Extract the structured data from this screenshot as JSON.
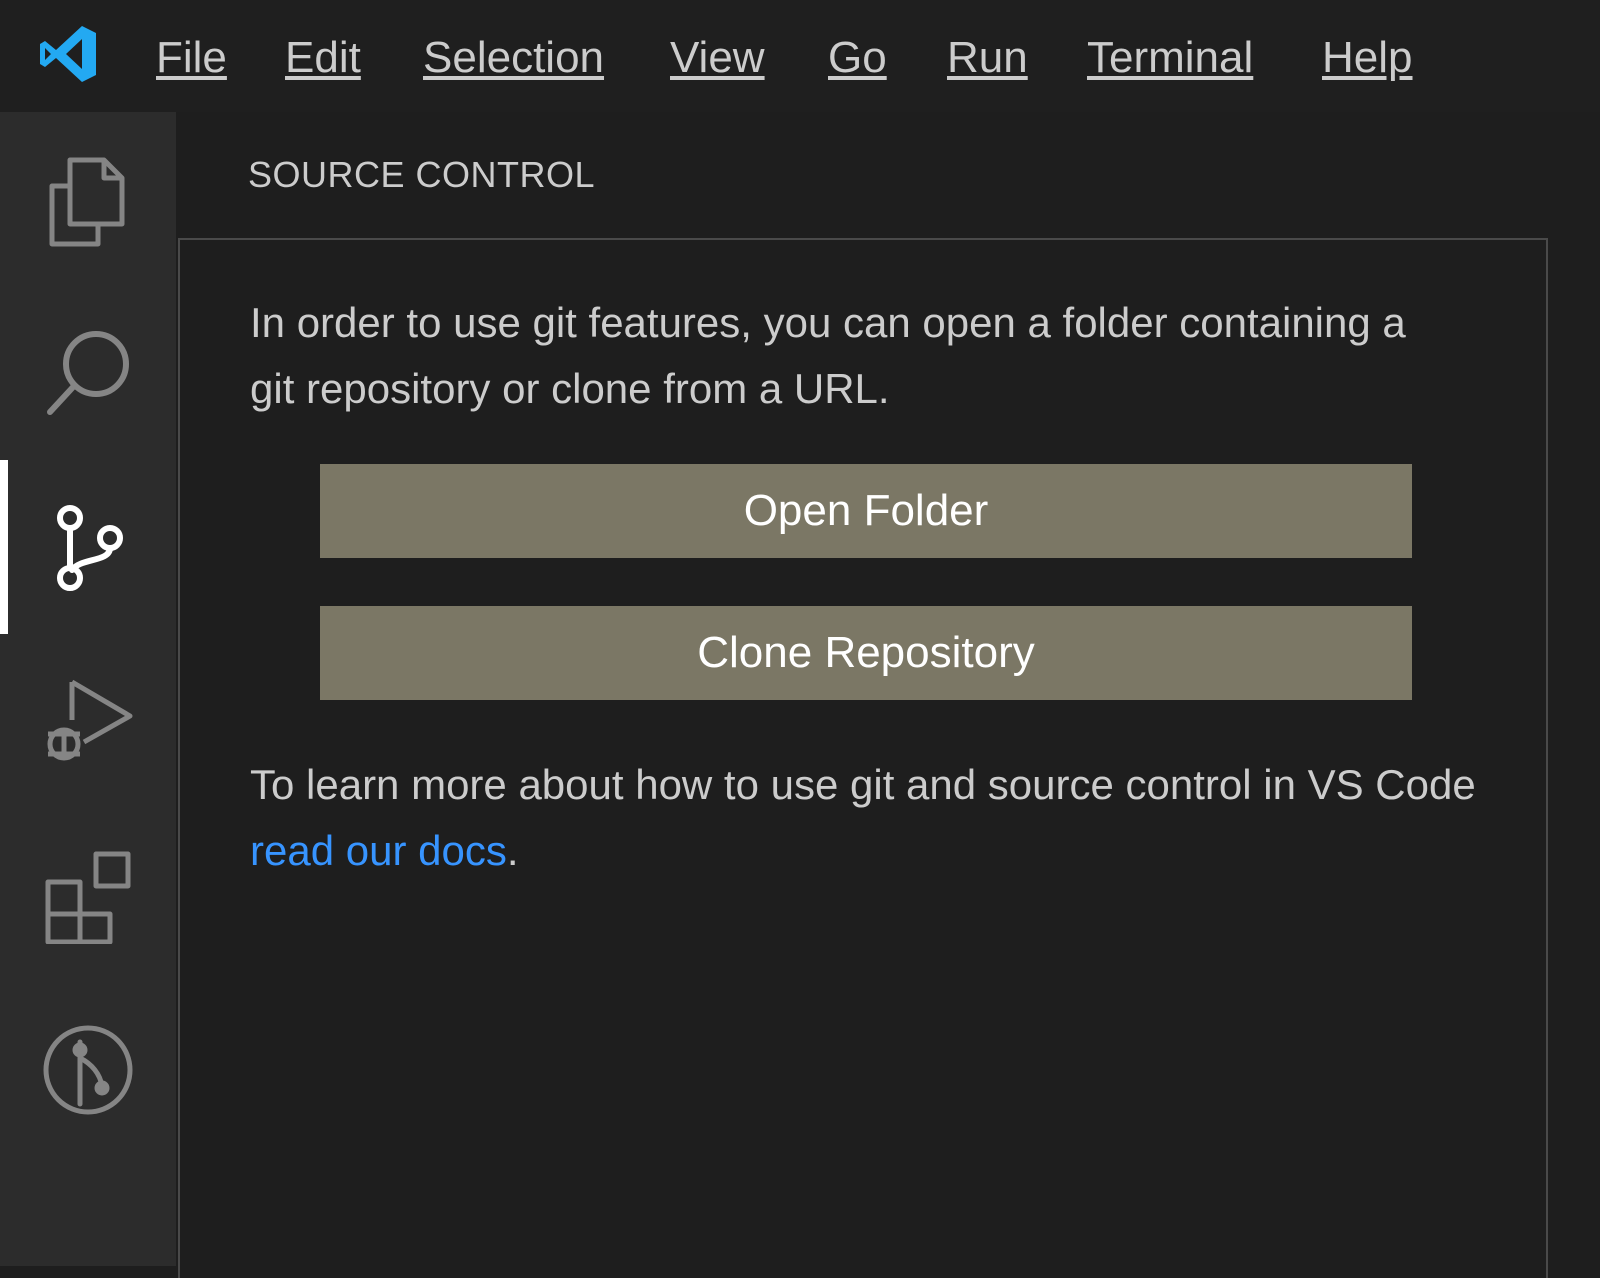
{
  "app": {
    "logo_icon": "vscode-logo-icon",
    "accent_color": "#23a9f2"
  },
  "menu": {
    "items": [
      {
        "label": "File"
      },
      {
        "label": "Edit"
      },
      {
        "label": "Selection"
      },
      {
        "label": "View"
      },
      {
        "label": "Go"
      },
      {
        "label": "Run"
      },
      {
        "label": "Terminal"
      },
      {
        "label": "Help"
      }
    ]
  },
  "activity_bar": {
    "items": [
      {
        "icon": "explorer-icon",
        "active": false
      },
      {
        "icon": "search-icon",
        "active": false
      },
      {
        "icon": "source-control-icon",
        "active": true
      },
      {
        "icon": "run-and-debug-icon",
        "active": false
      },
      {
        "icon": "extensions-icon",
        "active": false
      },
      {
        "icon": "git-graph-icon",
        "active": false
      }
    ]
  },
  "sidebar": {
    "title": "SOURCE CONTROL",
    "intro_text": "In order to use git features, you can open a folder containing a git repository or clone from a URL.",
    "open_folder_label": "Open Folder",
    "clone_repository_label": "Clone Repository",
    "docs_text_prefix": "To learn more about how to use git and source control in VS Code ",
    "docs_link_label": "read our docs",
    "docs_text_suffix": ".",
    "button_color": "#7b7765",
    "link_color": "#3794ff"
  }
}
